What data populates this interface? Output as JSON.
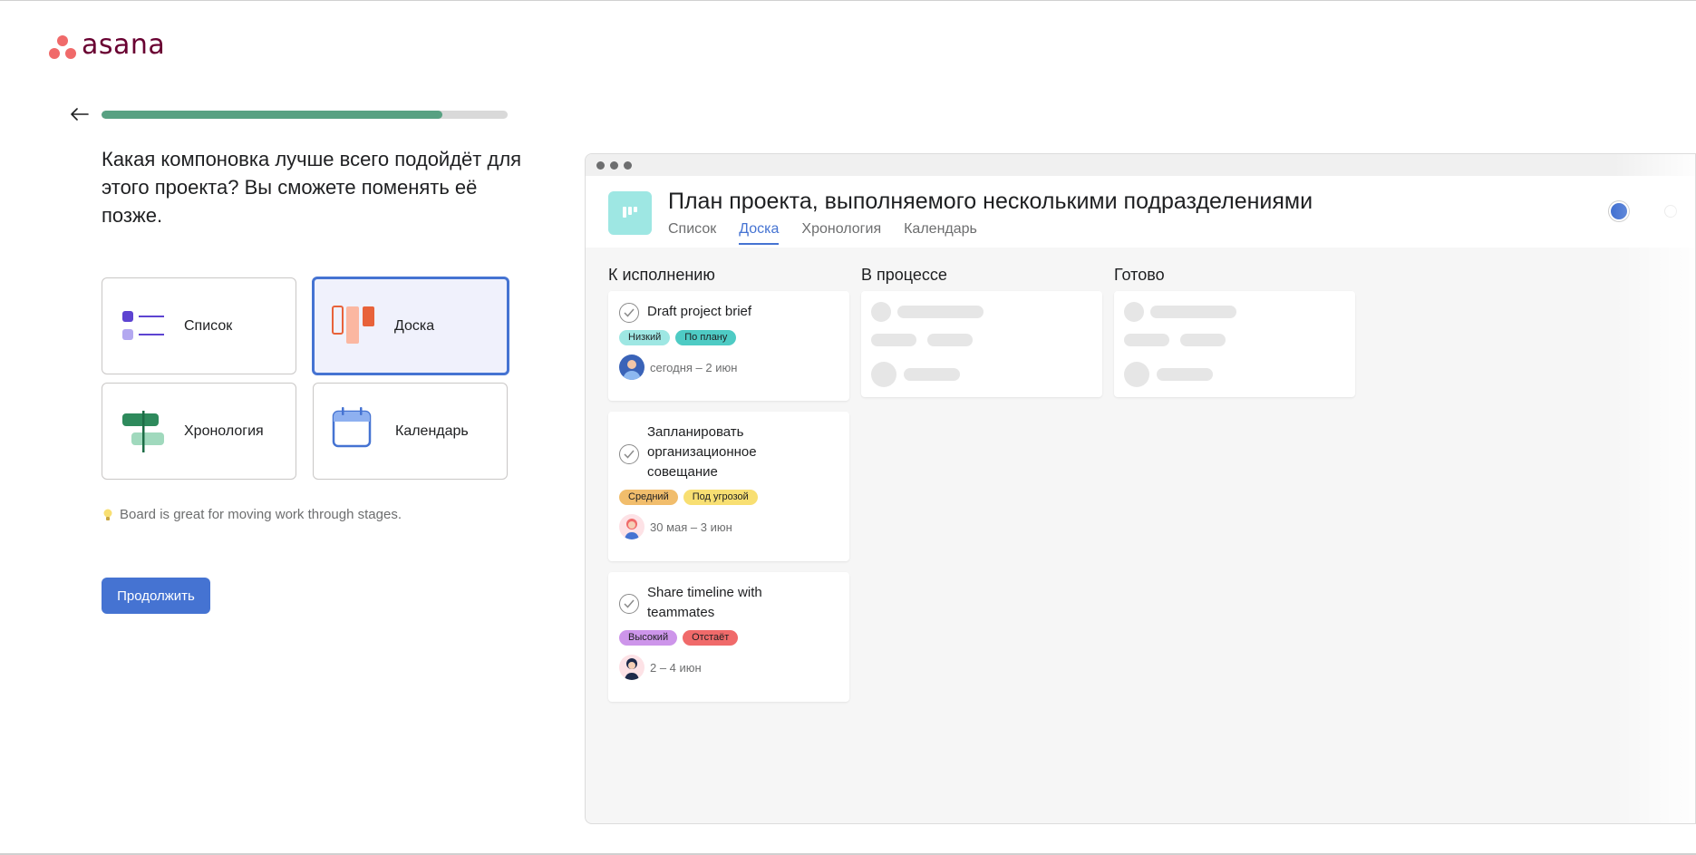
{
  "brand": {
    "name": "asana",
    "logo_color": "#f06a6a",
    "wordmark_color": "#690031"
  },
  "progress": {
    "value": 0.84,
    "fill_color": "#58a182"
  },
  "question": "Какая компоновка лучше всего подойдёт для этого проекта? Вы сможете поменять её позже.",
  "options": [
    {
      "label": "Список",
      "icon": "list-layout-icon",
      "selected": false
    },
    {
      "label": "Доска",
      "icon": "board-layout-icon",
      "selected": true
    },
    {
      "label": "Хронология",
      "icon": "timeline-layout-icon",
      "selected": false
    },
    {
      "label": "Календарь",
      "icon": "calendar-layout-icon",
      "selected": false
    }
  ],
  "tip": {
    "icon": "lightbulb-icon",
    "text": "Board is great for moving work through stages."
  },
  "continue_label": "Продолжить",
  "preview": {
    "title": "План проекта, выполняемого несколькими подразделениями",
    "tabs": [
      {
        "label": "Список",
        "active": false
      },
      {
        "label": "Доска",
        "active": true
      },
      {
        "label": "Хронология",
        "active": false
      },
      {
        "label": "Календарь",
        "active": false
      }
    ],
    "columns": [
      {
        "title": "К исполнению",
        "tasks": [
          {
            "name": "Draft project brief",
            "tags": [
              {
                "label": "Низкий",
                "color": "#9ee7e3"
              },
              {
                "label": "По плану",
                "color": "#4ecbc4"
              }
            ],
            "date": "сегодня – 2 июн"
          },
          {
            "name": "Запланировать организационное совещание",
            "tags": [
              {
                "label": "Средний",
                "color": "#f1bd6c"
              },
              {
                "label": "Под угрозой",
                "color": "#f8df72"
              }
            ],
            "date": "30 мая – 3 июн"
          },
          {
            "name": "Share timeline with teammates",
            "tags": [
              {
                "label": "Высокий",
                "color": "#cd95ea"
              },
              {
                "label": "Отстаёт",
                "color": "#f06a6a"
              }
            ],
            "date": "2 – 4 июн"
          }
        ]
      },
      {
        "title": "В процессе",
        "tasks": []
      },
      {
        "title": "Готово",
        "tasks": []
      }
    ]
  }
}
